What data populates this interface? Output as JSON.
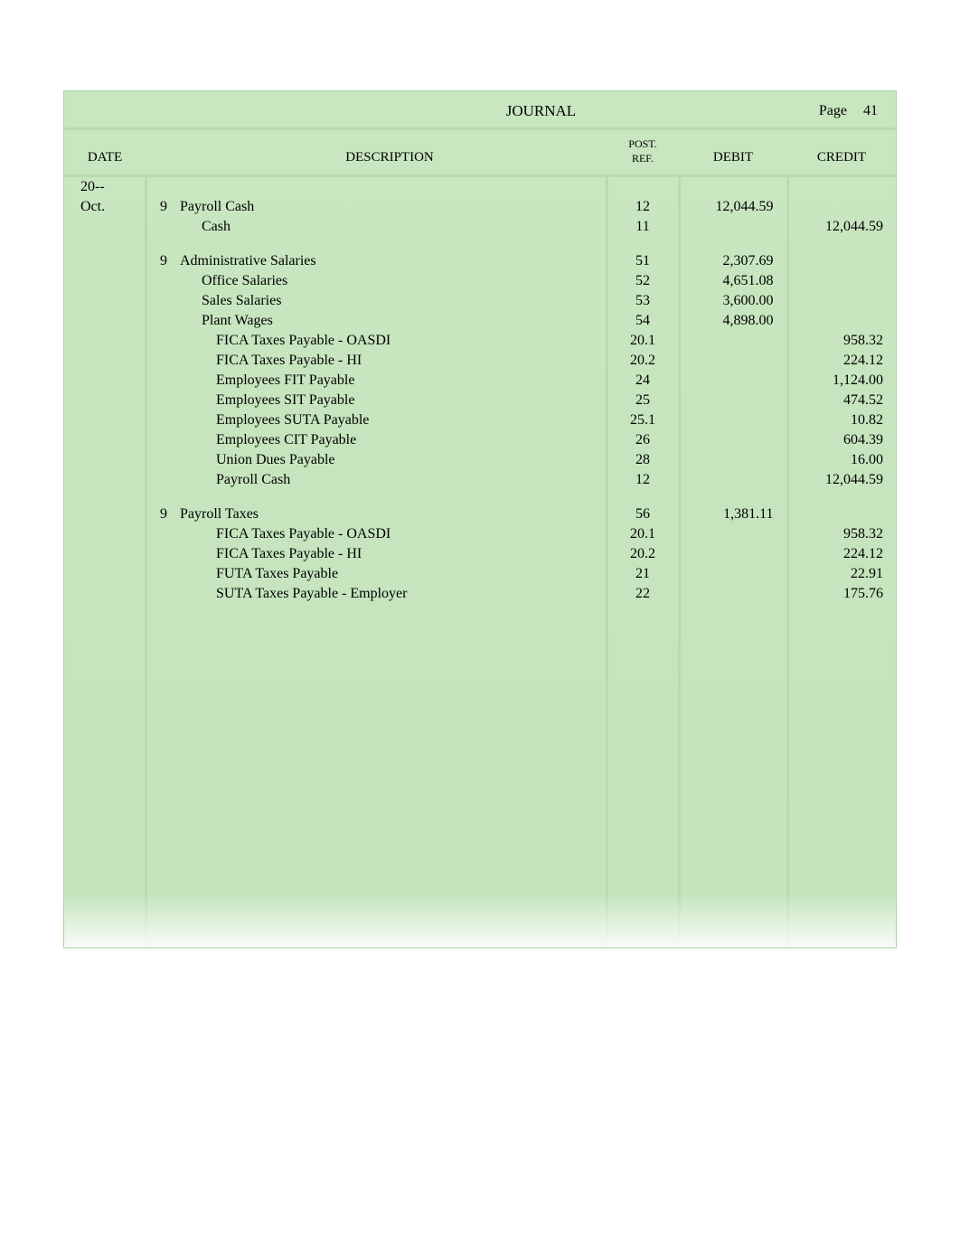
{
  "header": {
    "title": "JOURNAL",
    "page_label": "Page",
    "page_number": "41"
  },
  "columns": {
    "date": "DATE",
    "description": "DESCRIPTION",
    "postref_l1": "POST.",
    "postref_l2": "REF.",
    "debit": "DEBIT",
    "credit": "CREDIT"
  },
  "date_prefix": {
    "year": "20--",
    "month": "Oct."
  },
  "rows": [
    {
      "day": "9",
      "desc": "Payroll Cash",
      "indent": 0,
      "ref": "12",
      "debit": "12,044.59",
      "credit": ""
    },
    {
      "day": "",
      "desc": "Cash",
      "indent": 1,
      "ref": "11",
      "debit": "",
      "credit": "12,044.59"
    },
    {
      "spacer": true
    },
    {
      "day": "9",
      "desc": "Administrative Salaries",
      "indent": 0,
      "ref": "51",
      "debit": "2,307.69",
      "credit": ""
    },
    {
      "day": "",
      "desc": "Office Salaries",
      "indent": 1,
      "ref": "52",
      "debit": "4,651.08",
      "credit": ""
    },
    {
      "day": "",
      "desc": "Sales Salaries",
      "indent": 1,
      "ref": "53",
      "debit": "3,600.00",
      "credit": ""
    },
    {
      "day": "",
      "desc": "Plant Wages",
      "indent": 1,
      "ref": "54",
      "debit": "4,898.00",
      "credit": ""
    },
    {
      "day": "",
      "desc": "FICA Taxes Payable - OASDI",
      "indent": 2,
      "ref": "20.1",
      "debit": "",
      "credit": "958.32"
    },
    {
      "day": "",
      "desc": "FICA Taxes Payable - HI",
      "indent": 2,
      "ref": "20.2",
      "debit": "",
      "credit": "224.12"
    },
    {
      "day": "",
      "desc": "Employees FIT Payable",
      "indent": 2,
      "ref": "24",
      "debit": "",
      "credit": "1,124.00"
    },
    {
      "day": "",
      "desc": "Employees SIT Payable",
      "indent": 2,
      "ref": "25",
      "debit": "",
      "credit": "474.52"
    },
    {
      "day": "",
      "desc": "Employees SUTA Payable",
      "indent": 2,
      "ref": "25.1",
      "debit": "",
      "credit": "10.82"
    },
    {
      "day": "",
      "desc": "Employees CIT Payable",
      "indent": 2,
      "ref": "26",
      "debit": "",
      "credit": "604.39"
    },
    {
      "day": "",
      "desc": "Union Dues Payable",
      "indent": 2,
      "ref": "28",
      "debit": "",
      "credit": "16.00"
    },
    {
      "day": "",
      "desc": "Payroll Cash",
      "indent": 2,
      "ref": "12",
      "debit": "",
      "credit": "12,044.59"
    },
    {
      "spacer": true
    },
    {
      "day": "9",
      "desc": "Payroll Taxes",
      "indent": 0,
      "ref": "56",
      "debit": "1,381.11",
      "credit": ""
    },
    {
      "day": "",
      "desc": "FICA Taxes Payable - OASDI",
      "indent": 2,
      "ref": "20.1",
      "debit": "",
      "credit": "958.32"
    },
    {
      "day": "",
      "desc": "FICA Taxes Payable - HI",
      "indent": 2,
      "ref": "20.2",
      "debit": "",
      "credit": "224.12"
    },
    {
      "day": "",
      "desc": "FUTA Taxes Payable",
      "indent": 2,
      "ref": "21",
      "debit": "",
      "credit": "22.91"
    },
    {
      "day": "",
      "desc": "SUTA Taxes Payable - Employer",
      "indent": 2,
      "ref": "22",
      "debit": "",
      "credit": "175.76"
    }
  ]
}
